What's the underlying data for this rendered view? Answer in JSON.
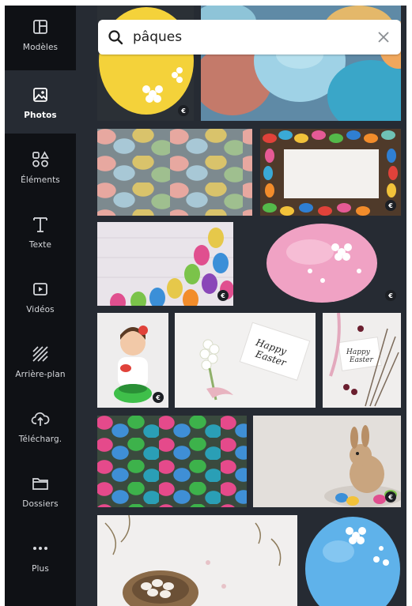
{
  "sidebar": {
    "items": [
      {
        "label": "Modèles",
        "icon": "layout-icon",
        "active": false
      },
      {
        "label": "Photos",
        "icon": "image-icon",
        "active": true
      },
      {
        "label": "Éléments",
        "icon": "shapes-icon",
        "active": false
      },
      {
        "label": "Texte",
        "icon": "text-icon",
        "active": false
      },
      {
        "label": "Vidéos",
        "icon": "video-icon",
        "active": false
      },
      {
        "label": "Arrière-plan",
        "icon": "background-pattern-icon",
        "active": false
      },
      {
        "label": "Télécharg.",
        "icon": "cloud-upload-icon",
        "active": false
      },
      {
        "label": "Dossiers",
        "icon": "folder-icon",
        "active": false
      },
      {
        "label": "Plus",
        "icon": "more-dots-icon",
        "active": false
      }
    ]
  },
  "search": {
    "value": "pâques",
    "icon": "search-icon",
    "clear_icon": "close-icon"
  },
  "photos": {
    "premium_badge": "€",
    "items": [
      {
        "subject": "yellow-egg",
        "premium": true
      },
      {
        "subject": "pastel-eggs-closeup",
        "premium": false
      },
      {
        "subject": "speckled-eggs",
        "premium": false
      },
      {
        "subject": "eggs-frame-card",
        "premium": true
      },
      {
        "subject": "eggs-on-wood",
        "premium": true
      },
      {
        "subject": "pink-egg",
        "premium": true
      },
      {
        "subject": "girl-with-basket",
        "premium": true
      },
      {
        "subject": "happy-easter-card-hyacinth",
        "premium": false,
        "card_text": "Happy Easter"
      },
      {
        "subject": "happy-easter-card-willow",
        "premium": false,
        "card_text": "Happy Easter"
      },
      {
        "subject": "foil-eggs",
        "premium": false
      },
      {
        "subject": "bunny-figurine",
        "premium": true
      },
      {
        "subject": "nest-with-eggs",
        "premium": false
      },
      {
        "subject": "blue-egg",
        "premium": false
      }
    ]
  },
  "colors": {
    "sidebar_bg": "#0f1115",
    "panel_bg": "#262b33",
    "sidebar_text": "#d6d8dc",
    "search_bg": "#ffffff"
  }
}
